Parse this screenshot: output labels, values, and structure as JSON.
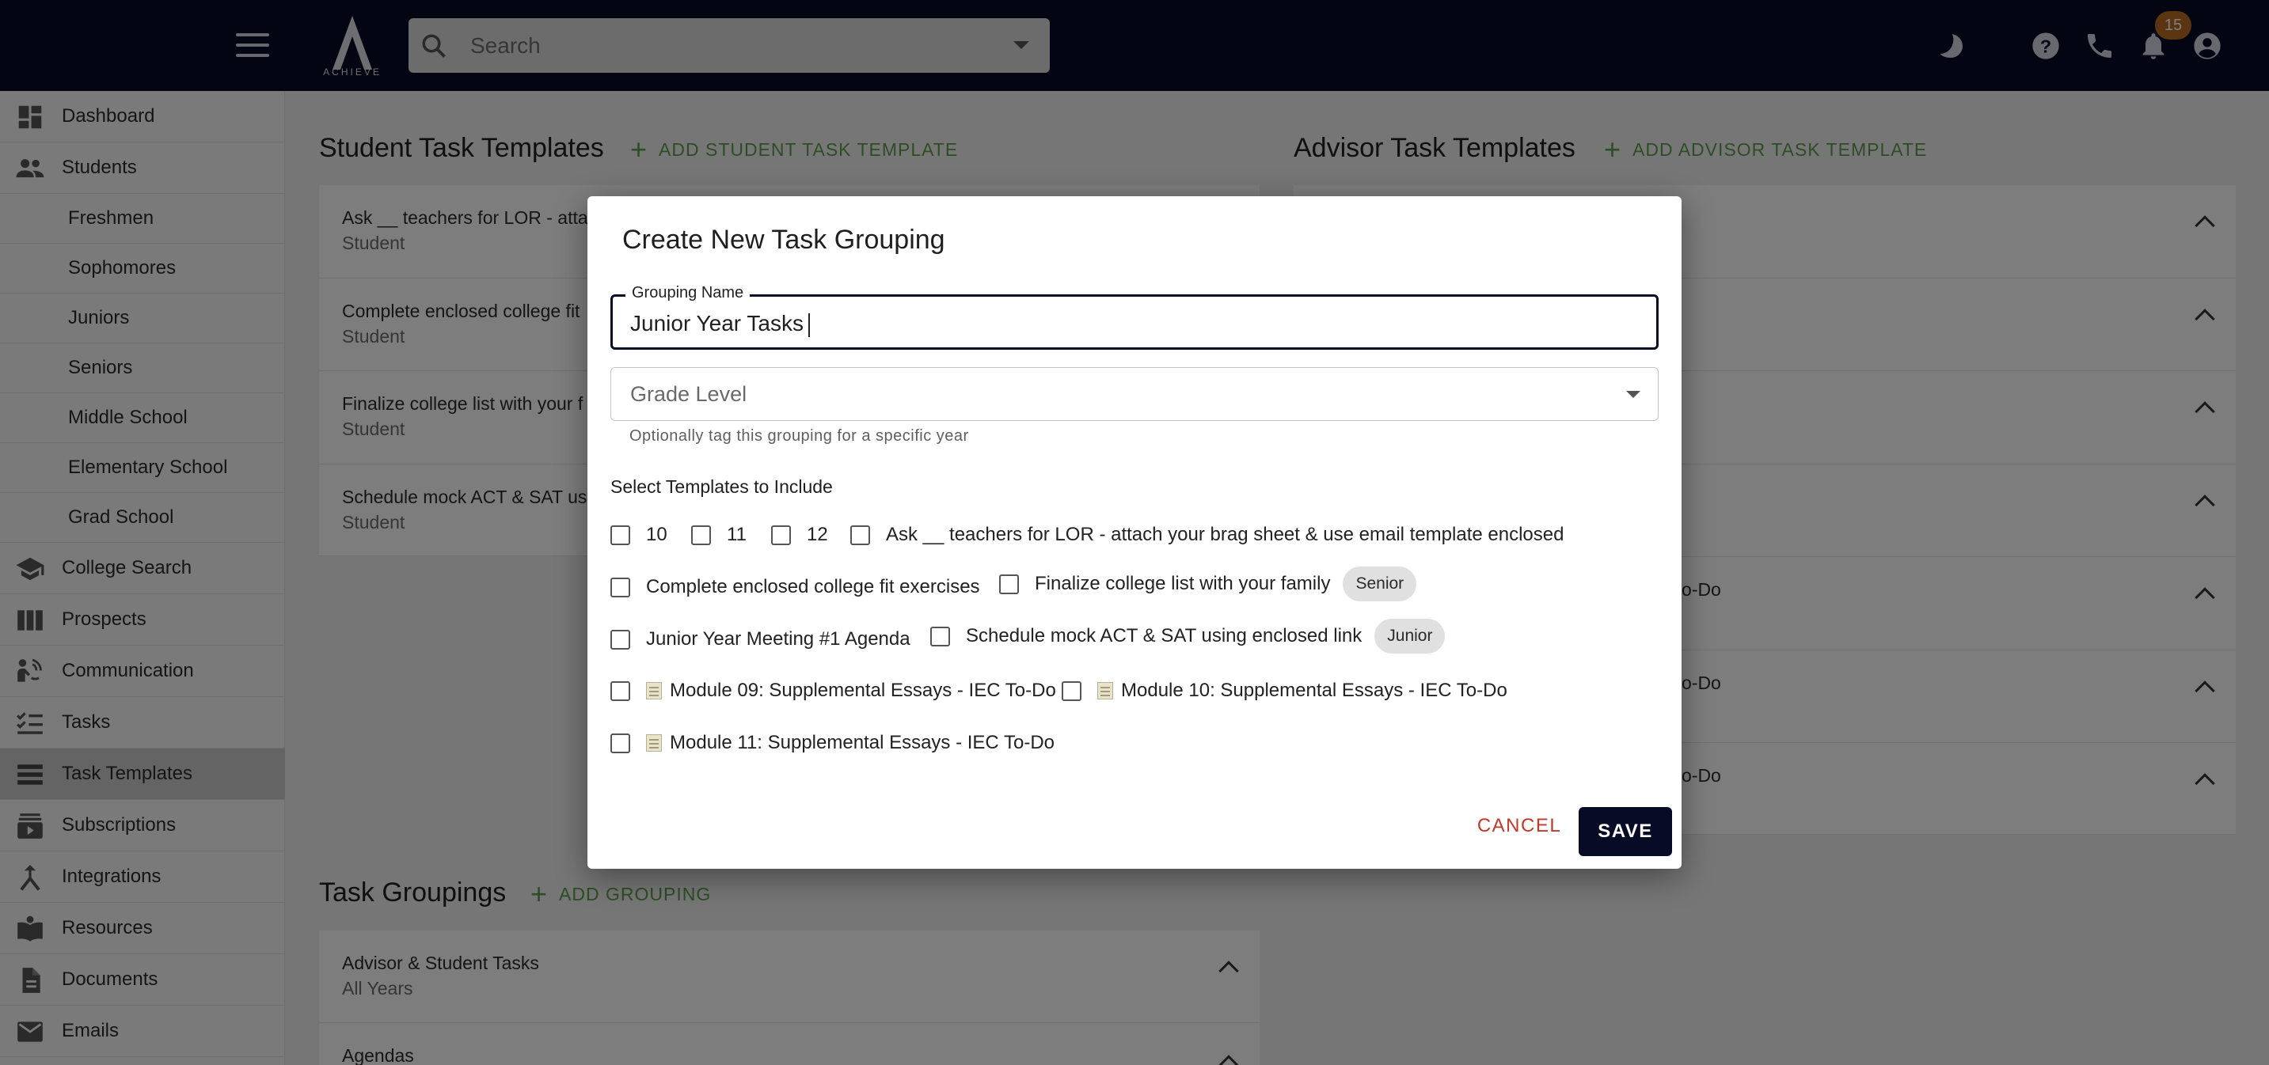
{
  "topbar": {
    "logo_text": "ACHIEVE",
    "search_placeholder": "Search",
    "notification_count": "15",
    "icons": [
      "menu-icon",
      "search-icon",
      "dropdown-icon",
      "moon-icon",
      "help-icon",
      "phone-icon",
      "notifications-icon",
      "account-icon"
    ]
  },
  "sidebar": {
    "items": [
      {
        "label": "Dashboard",
        "icon": "dashboard-icon"
      },
      {
        "label": "Students",
        "icon": "people-icon"
      },
      {
        "label": "Freshmen"
      },
      {
        "label": "Sophomores"
      },
      {
        "label": "Juniors"
      },
      {
        "label": "Seniors"
      },
      {
        "label": "Middle School"
      },
      {
        "label": "Elementary School"
      },
      {
        "label": "Grad School"
      },
      {
        "label": "College Search",
        "icon": "school-icon"
      },
      {
        "label": "Prospects",
        "icon": "columns-icon"
      },
      {
        "label": "Communication",
        "icon": "communication-icon"
      },
      {
        "label": "Tasks",
        "icon": "checklist-icon"
      },
      {
        "label": "Task Templates",
        "icon": "list-icon",
        "active": true
      },
      {
        "label": "Subscriptions",
        "icon": "subscriptions-icon"
      },
      {
        "label": "Integrations",
        "icon": "merge-icon"
      },
      {
        "label": "Resources",
        "icon": "book-icon"
      },
      {
        "label": "Documents",
        "icon": "document-icon"
      },
      {
        "label": "Emails",
        "icon": "mail-icon"
      }
    ]
  },
  "main": {
    "student_templates": {
      "title": "Student Task Templates",
      "add_label": "ADD STUDENT TASK TEMPLATE",
      "cards": [
        {
          "title": "Ask __ teachers for LOR - atta",
          "subtitle": "Student"
        },
        {
          "title": "Complete enclosed college fit",
          "subtitle": "Student"
        },
        {
          "title": "Finalize college list with your f",
          "subtitle": "Student"
        },
        {
          "title": "Schedule mock ACT & SAT usi",
          "subtitle": "Student"
        }
      ]
    },
    "advisor_templates": {
      "title": "Advisor Task Templates",
      "add_label": "ADD ADVISOR TASK TEMPLATE",
      "cards": [
        {
          "title": ""
        },
        {
          "title": ""
        },
        {
          "title": ""
        },
        {
          "title": ""
        },
        {
          "title": "o-Do"
        },
        {
          "title": "o-Do"
        },
        {
          "title": "o-Do"
        }
      ]
    },
    "groupings": {
      "title": "Task Groupings",
      "add_label": "ADD GROUPING",
      "cards": [
        {
          "title": "Advisor & Student Tasks",
          "subtitle": "All Years"
        },
        {
          "title": "Agendas",
          "subtitle": ""
        }
      ]
    }
  },
  "dialog": {
    "title": "Create New Task Grouping",
    "grouping_name_label": "Grouping Name",
    "grouping_name_value": "Junior Year Tasks",
    "grade_level_placeholder": "Grade Level",
    "grade_level_helper": "Optionally tag this grouping for a specific year",
    "select_label": "Select Templates to Include",
    "options": [
      {
        "label": "10"
      },
      {
        "label": "11"
      },
      {
        "label": "12"
      },
      {
        "label": "Ask __ teachers for LOR - attach your brag sheet & use email template enclosed"
      },
      {
        "label": "Complete enclosed college fit exercises"
      },
      {
        "label": "Finalize college list with your family",
        "chip": "Senior"
      },
      {
        "label": "Junior Year Meeting #1 Agenda"
      },
      {
        "label": "Schedule mock ACT & SAT using enclosed link",
        "chip": "Junior"
      },
      {
        "label": "Module 09: Supplemental Essays - IEC To-Do",
        "icon": "memo-icon"
      },
      {
        "label": "Module 10: Supplemental Essays - IEC To-Do",
        "icon": "memo-icon"
      },
      {
        "label": "Module 11: Supplemental Essays - IEC To-Do",
        "icon": "memo-icon"
      }
    ],
    "cancel_label": "CANCEL",
    "save_label": "SAVE"
  },
  "colors": {
    "topbar": "#070b26",
    "accent_green": "#5a9a4a",
    "cancel_red": "#c0392b",
    "chip_bg": "#e0e0e0",
    "badge": "#b66a24"
  }
}
